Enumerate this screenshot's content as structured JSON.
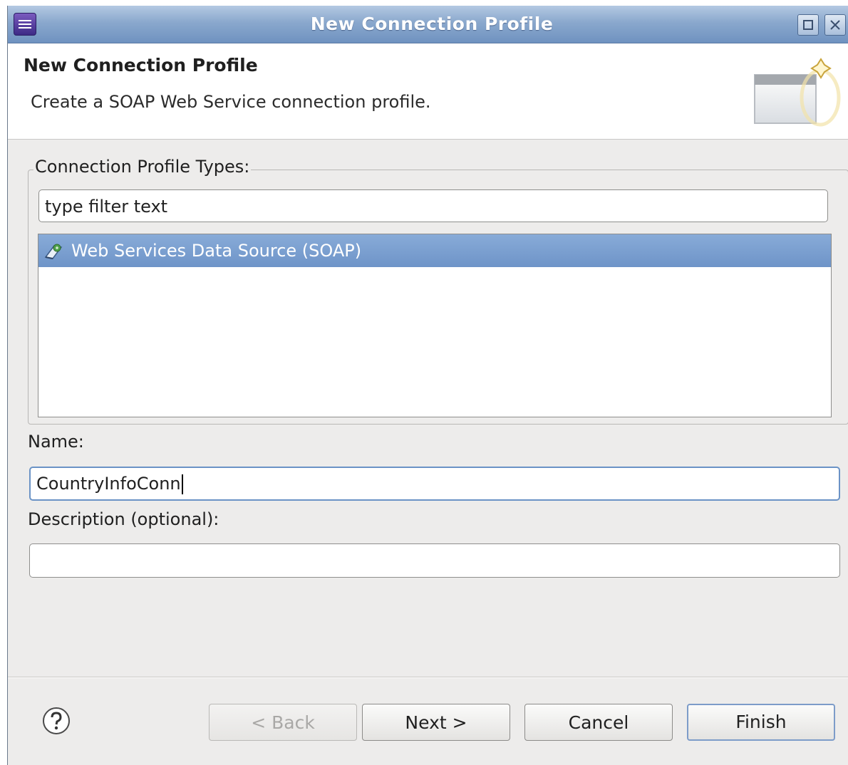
{
  "window": {
    "title": "New Connection Profile"
  },
  "banner": {
    "title": "New Connection Profile",
    "description": "Create a SOAP Web Service connection profile."
  },
  "profile_types": {
    "group_label": "Connection Profile Types:",
    "filter_placeholder": "type filter text",
    "items": [
      {
        "label": "Web Services Data Source (SOAP)",
        "selected": true,
        "icon": "web-service-icon"
      }
    ]
  },
  "name": {
    "label": "Name:",
    "value": "CountryInfoConn"
  },
  "description": {
    "label": "Description (optional):",
    "value": ""
  },
  "buttons": {
    "back": "< Back",
    "next": "Next >",
    "cancel": "Cancel",
    "finish": "Finish"
  },
  "colors": {
    "titlebar": "#8aa8cd",
    "selection": "#7a9fd0",
    "dialog_bg": "#edeceb"
  }
}
